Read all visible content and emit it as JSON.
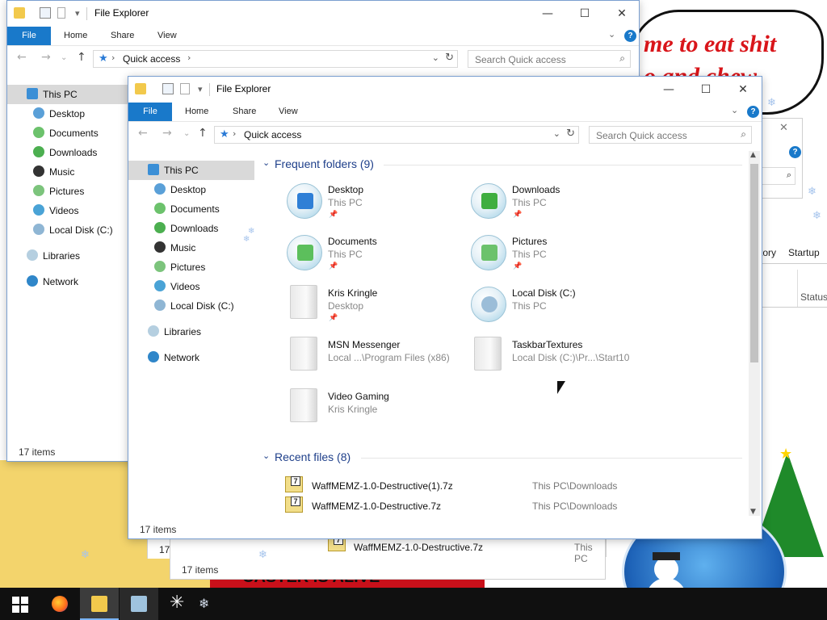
{
  "desktop": {
    "bubble_line1": "me to eat shit",
    "bubble_line2": "o and chew",
    "red_banner_text": "CASTER IS ALIVE"
  },
  "back_window": {
    "tabs_visible": [
      "tory",
      "Startup"
    ],
    "column_status": "Status",
    "recent_partial_name": "WaffMEMZ-1.0-Destructive.7z",
    "recent_partial_loc": "This PC",
    "status": "17 items"
  },
  "window1": {
    "title": "File Explorer",
    "ribbon": {
      "file": "File",
      "home": "Home",
      "share": "Share",
      "view": "View"
    },
    "address": "Quick access",
    "search_placeholder": "Search Quick access",
    "nav": [
      "This PC",
      "Desktop",
      "Documents",
      "Downloads",
      "Music",
      "Pictures",
      "Videos",
      "Local Disk (C:)",
      "Libraries",
      "Network"
    ],
    "status": "17 items"
  },
  "window2": {
    "title": "File Explorer",
    "ribbon": {
      "file": "File",
      "home": "Home",
      "share": "Share",
      "view": "View"
    },
    "address": "Quick access",
    "search_placeholder": "Search Quick access",
    "nav": [
      "This PC",
      "Desktop",
      "Documents",
      "Downloads",
      "Music",
      "Pictures",
      "Videos",
      "Local Disk (C:)",
      "Libraries",
      "Network"
    ],
    "frequent_header": "Frequent folders (9)",
    "frequent": [
      {
        "name": "Desktop",
        "location": "This PC"
      },
      {
        "name": "Downloads",
        "location": "This PC"
      },
      {
        "name": "Documents",
        "location": "This PC"
      },
      {
        "name": "Pictures",
        "location": "This PC"
      },
      {
        "name": "Kris Kringle",
        "location": "Desktop"
      },
      {
        "name": "Local Disk (C:)",
        "location": "This PC"
      },
      {
        "name": "MSN Messenger",
        "location": "Local ...\\Program Files (x86)"
      },
      {
        "name": "TaskbarTextures",
        "location": "Local Disk (C:)\\Pr...\\Start10"
      },
      {
        "name": "Video Gaming",
        "location": "Kris Kringle"
      }
    ],
    "recent_header": "Recent files (8)",
    "recent": [
      {
        "name": "WaffMEMZ-1.0-Destructive(1).7z",
        "location": "This PC\\Downloads"
      },
      {
        "name": "WaffMEMZ-1.0-Destructive.7z",
        "location": "This PC\\Downloads"
      }
    ],
    "status": "17 items"
  },
  "controls": {
    "minimize": "—",
    "maximize": "☐",
    "close": "✕"
  },
  "colors": {
    "accent": "#1979ca",
    "selection": "#d9d9d9",
    "header_blue": "#1e3f8a"
  },
  "taskbar": {
    "items": [
      "windows-start-icon",
      "firefox-icon",
      "file-explorer-icon",
      "control-panel-icon",
      "snowflake-app-icon",
      "snowflake-icon"
    ]
  }
}
